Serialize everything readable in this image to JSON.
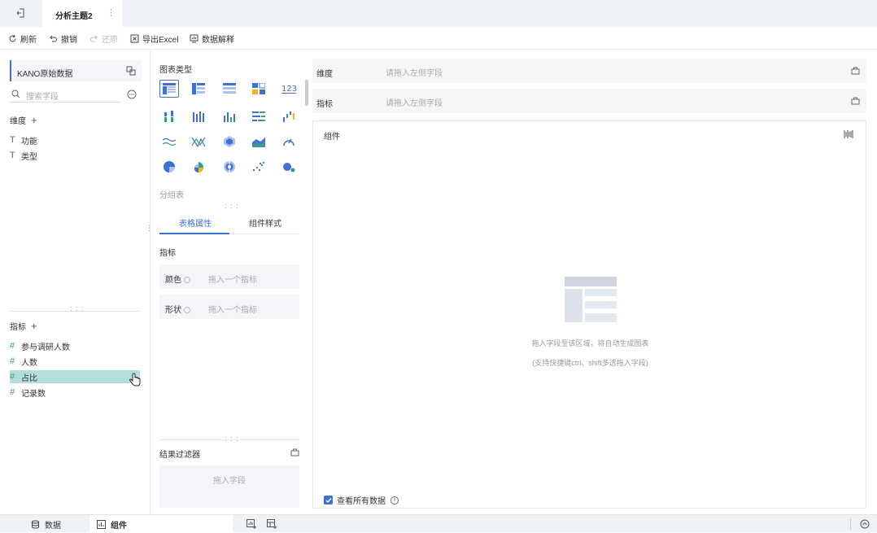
{
  "topbar": {
    "tab_title": "分析主题2",
    "more": "⋮"
  },
  "toolbar": {
    "refresh": "刷新",
    "undo": "撤销",
    "redo": "还原",
    "export": "导出Excel",
    "explain": "数据解释"
  },
  "left": {
    "dataset": "KANO原始数据",
    "search_placeholder": "搜索字段",
    "dimension_title": "维度",
    "dimensions": [
      {
        "icon": "T",
        "label": "功能"
      },
      {
        "icon": "T",
        "label": "类型"
      }
    ],
    "measure_title": "指标",
    "measures": [
      {
        "icon": "#",
        "label": "参与调研人数"
      },
      {
        "icon": "#",
        "label": "人数"
      },
      {
        "icon": "#",
        "label": "占比"
      },
      {
        "icon": "#",
        "label": "记录数"
      }
    ]
  },
  "middle": {
    "chart_type_title": "图表类型",
    "selected_chart_name": "分组表",
    "tabs": [
      "表格属性",
      "组件样式"
    ],
    "measure_section": "指标",
    "props": [
      {
        "name": "颜色",
        "placeholder": "拖入一个指标"
      },
      {
        "name": "形状",
        "placeholder": "拖入一个指标"
      }
    ],
    "filter_title": "结果过滤器",
    "filter_placeholder": "拖入字段"
  },
  "right": {
    "dim_label": "维度",
    "dim_placeholder": "请拖入左侧字段",
    "measure_label": "指标",
    "measure_placeholder": "请拖入左侧字段",
    "component_title": "组件",
    "hint1": "拖入字段至该区域，将自动生成图表",
    "hint2": "(支持快捷键ctrl、shift多选拖入字段)",
    "show_all": "查看所有数据"
  },
  "bottom": {
    "data_tab": "数据",
    "component_tab": "组件"
  },
  "colors": {
    "accent": "#3f6fd8",
    "selected_field": "#b2dfdb",
    "field_icon": "#3a9a92"
  }
}
